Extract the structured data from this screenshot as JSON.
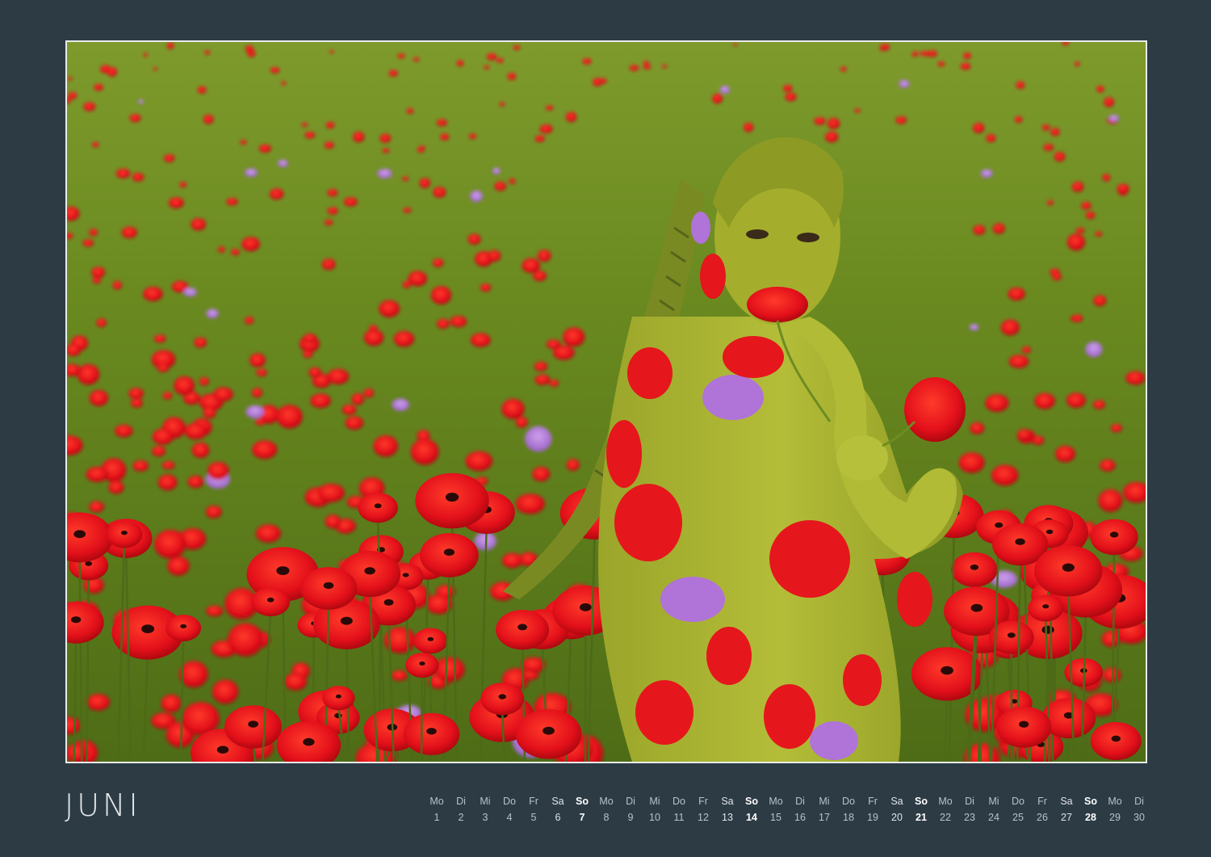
{
  "month": {
    "title": "JUNI"
  },
  "calendar": {
    "days": [
      {
        "weekday": "Mo",
        "date": "1",
        "kind": "weekday"
      },
      {
        "weekday": "Di",
        "date": "2",
        "kind": "weekday"
      },
      {
        "weekday": "Mi",
        "date": "3",
        "kind": "weekday"
      },
      {
        "weekday": "Do",
        "date": "4",
        "kind": "weekday"
      },
      {
        "weekday": "Fr",
        "date": "5",
        "kind": "weekday"
      },
      {
        "weekday": "Sa",
        "date": "6",
        "kind": "saturday"
      },
      {
        "weekday": "So",
        "date": "7",
        "kind": "sunday"
      },
      {
        "weekday": "Mo",
        "date": "8",
        "kind": "weekday"
      },
      {
        "weekday": "Di",
        "date": "9",
        "kind": "weekday"
      },
      {
        "weekday": "Mi",
        "date": "10",
        "kind": "weekday"
      },
      {
        "weekday": "Do",
        "date": "11",
        "kind": "weekday"
      },
      {
        "weekday": "Fr",
        "date": "12",
        "kind": "weekday"
      },
      {
        "weekday": "Sa",
        "date": "13",
        "kind": "saturday"
      },
      {
        "weekday": "So",
        "date": "14",
        "kind": "sunday"
      },
      {
        "weekday": "Mo",
        "date": "15",
        "kind": "weekday"
      },
      {
        "weekday": "Di",
        "date": "16",
        "kind": "weekday"
      },
      {
        "weekday": "Mi",
        "date": "17",
        "kind": "weekday"
      },
      {
        "weekday": "Do",
        "date": "18",
        "kind": "weekday"
      },
      {
        "weekday": "Fr",
        "date": "19",
        "kind": "weekday"
      },
      {
        "weekday": "Sa",
        "date": "20",
        "kind": "saturday"
      },
      {
        "weekday": "So",
        "date": "21",
        "kind": "sunday"
      },
      {
        "weekday": "Mo",
        "date": "22",
        "kind": "weekday"
      },
      {
        "weekday": "Di",
        "date": "23",
        "kind": "weekday"
      },
      {
        "weekday": "Mi",
        "date": "24",
        "kind": "weekday"
      },
      {
        "weekday": "Do",
        "date": "25",
        "kind": "weekday"
      },
      {
        "weekday": "Fr",
        "date": "26",
        "kind": "weekday"
      },
      {
        "weekday": "Sa",
        "date": "27",
        "kind": "saturday"
      },
      {
        "weekday": "So",
        "date": "28",
        "kind": "sunday"
      },
      {
        "weekday": "Mo",
        "date": "29",
        "kind": "weekday"
      },
      {
        "weekday": "Di",
        "date": "30",
        "kind": "weekday"
      }
    ]
  },
  "colors": {
    "background": "#2d3b45",
    "frame_border": "#e9ece9",
    "poppy_red": "#e8141a",
    "field_green": "#6b8a22",
    "body_paint": "#a9b52e",
    "violet": "#b07ad6"
  }
}
